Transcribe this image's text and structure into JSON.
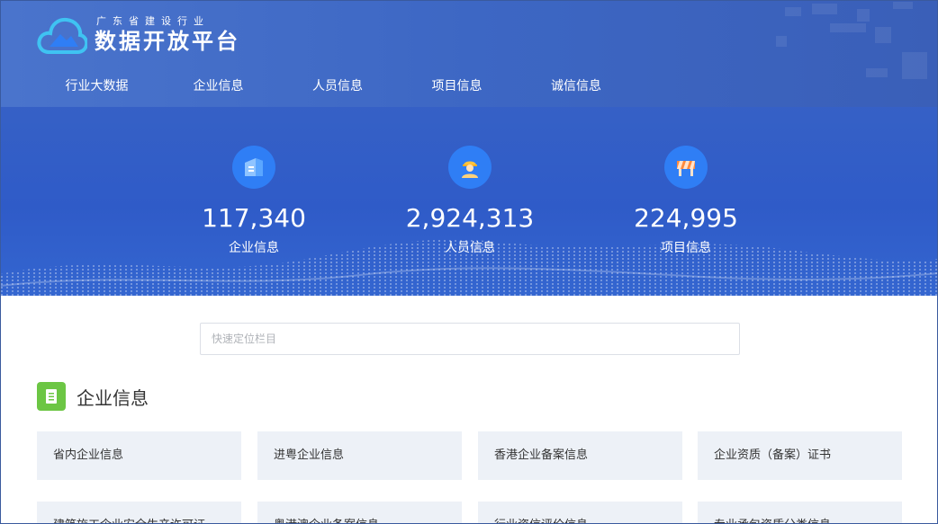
{
  "header": {
    "logo_subtitle": "广东省建设行业",
    "logo_title": "数据开放平台"
  },
  "nav": {
    "items": [
      {
        "label": "行业大数据"
      },
      {
        "label": "企业信息"
      },
      {
        "label": "人员信息"
      },
      {
        "label": "项目信息"
      },
      {
        "label": "诚信信息"
      }
    ]
  },
  "stats": [
    {
      "value": "117,340",
      "label": "企业信息",
      "icon": "building-icon"
    },
    {
      "value": "2,924,313",
      "label": "人员信息",
      "icon": "worker-icon"
    },
    {
      "value": "224,995",
      "label": "项目信息",
      "icon": "barrier-icon"
    }
  ],
  "search": {
    "placeholder": "快速定位栏目",
    "value": ""
  },
  "section": {
    "title": "企业信息",
    "icon": "document-icon"
  },
  "cards": [
    {
      "label": "省内企业信息"
    },
    {
      "label": "进粤企业信息"
    },
    {
      "label": "香港企业备案信息"
    },
    {
      "label": "企业资质（备案）证书"
    },
    {
      "label": "建筑施工企业安全生产许可证"
    },
    {
      "label": "粤港澳企业备案信息"
    },
    {
      "label": "行业资信评价信息"
    },
    {
      "label": "专业承包资质分类信息"
    }
  ],
  "colors": {
    "hero_bg": "#3560c6",
    "stat_icon_bg": "#2f7ef5",
    "section_icon_bg": "#6cc644",
    "card_bg": "#edf1f7"
  }
}
